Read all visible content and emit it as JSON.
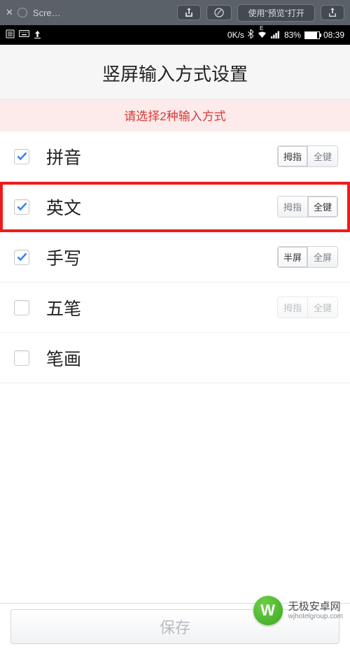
{
  "browser": {
    "tab_label": "Scre…",
    "open_label": "使用\"预览\"打开"
  },
  "status": {
    "speed": "0K/s",
    "battery_pct": "83%",
    "time": "08:39"
  },
  "page_title": "竖屏输入方式设置",
  "warning": "请选择2种输入方式",
  "rows": [
    {
      "label": "拼音",
      "checked": true,
      "seg": [
        "拇指",
        "全键"
      ],
      "active": 0
    },
    {
      "label": "英文",
      "checked": true,
      "seg": [
        "拇指",
        "全键"
      ],
      "active": 1,
      "highlight": true
    },
    {
      "label": "手写",
      "checked": true,
      "seg": [
        "半屏",
        "全屏"
      ],
      "active": 0
    },
    {
      "label": "五笔",
      "checked": false,
      "seg": [
        "拇指",
        "全键"
      ],
      "active": null,
      "disabled": true
    },
    {
      "label": "笔画",
      "checked": false
    }
  ],
  "save_label": "保存",
  "watermark": {
    "brand": "无极安卓网",
    "site": "wjhotelgroup.com"
  }
}
